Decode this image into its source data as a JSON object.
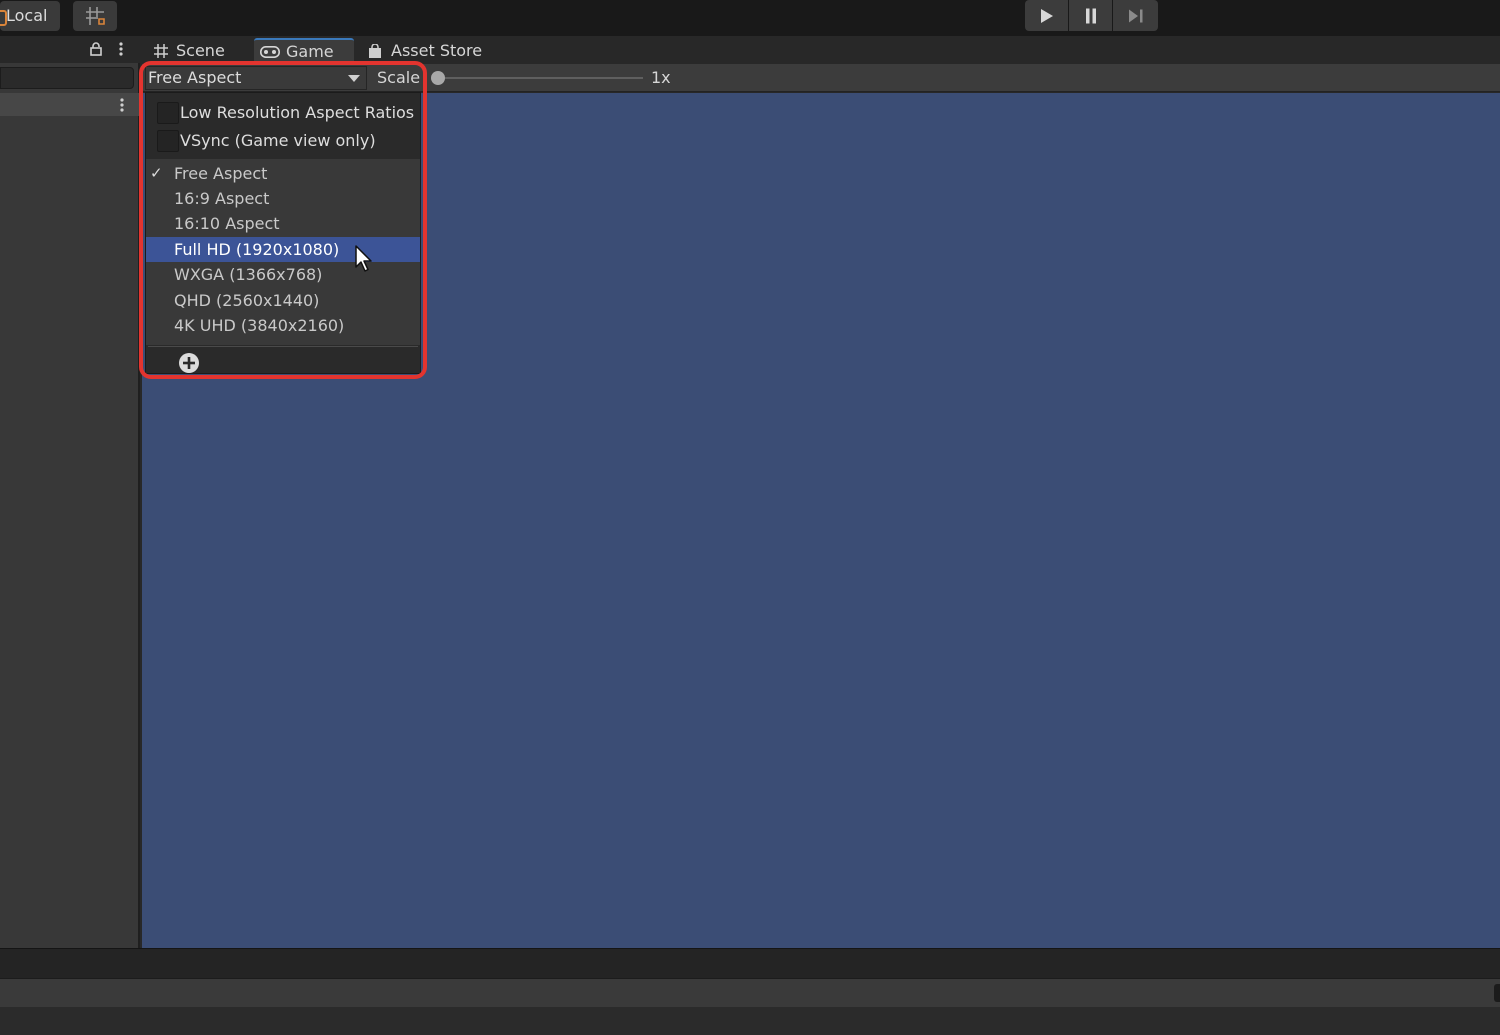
{
  "toolbar": {
    "local_label": "Local",
    "snap_icon": "grid-snap-icon",
    "play_icon": "play-icon",
    "pause_icon": "pause-icon",
    "step_icon": "step-icon"
  },
  "tabs": [
    {
      "label": "Scene",
      "icon": "scene-grid-icon"
    },
    {
      "label": "Game",
      "icon": "gamepad-icon",
      "active": true
    },
    {
      "label": "Asset Store",
      "icon": "shopping-bag-icon"
    }
  ],
  "game_toolbar": {
    "aspect_selected": "Free Aspect",
    "scale_label": "Scale",
    "scale_value": "1x"
  },
  "aspect_menu": {
    "checkboxes": [
      {
        "label": "Low Resolution Aspect Ratios",
        "checked": false
      },
      {
        "label": "VSync (Game view only)",
        "checked": false
      }
    ],
    "options": [
      {
        "label": "Free Aspect",
        "checked": true
      },
      {
        "label": "16:9 Aspect"
      },
      {
        "label": "16:10 Aspect"
      },
      {
        "label": "Full HD (1920x1080)",
        "hovered": true
      },
      {
        "label": "WXGA (1366x768)"
      },
      {
        "label": "QHD (2560x1440)"
      },
      {
        "label": "4K UHD (3840x2160)"
      }
    ],
    "add_icon": "plus-circle-icon"
  },
  "colors": {
    "game_view_bg": "#3b4d75",
    "highlight": "#e3342f",
    "selected_option": "#3c5497"
  }
}
